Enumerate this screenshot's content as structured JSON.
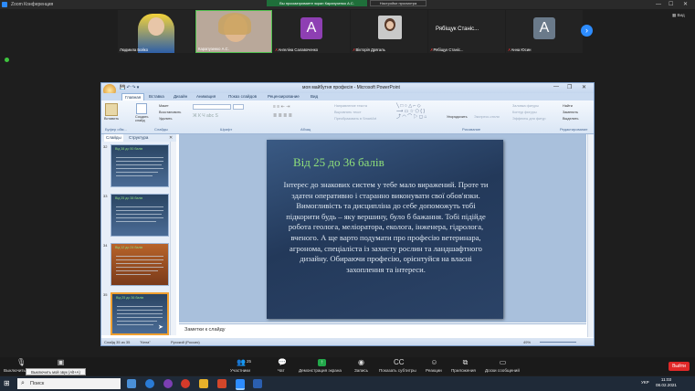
{
  "zoom": {
    "window_title": "Zoom Конференция",
    "banner": "Вы просматриваете экран Карапузенко А.С.",
    "banner_options": "Настройки просмотра",
    "view_label": "Вид",
    "participants": [
      {
        "name": "Людмила Бойко",
        "type": "video"
      },
      {
        "name": "Карапузенко А.С.",
        "type": "video"
      },
      {
        "name": "Ангеліна Салавоченко",
        "type": "avatar",
        "initial": "А",
        "color": "#8e3fb3",
        "muted": true
      },
      {
        "name": "Вікторія Дрягаль",
        "type": "photo",
        "muted": true
      },
      {
        "name": "Рябіщук Станіс...",
        "avatar_text": "Рябіщук Станіс...",
        "type": "text",
        "muted": true
      },
      {
        "name": "Анна Юсин",
        "type": "avatar",
        "initial": "А",
        "color": "#6a7a8a",
        "muted": true
      }
    ],
    "toolbar": {
      "audio": "Выключить",
      "video": "Включить",
      "participants": "Участники",
      "participants_count": "25",
      "chat": "Чат",
      "share": "Демонстрация экрана",
      "record": "Запись",
      "captions": "Показать субтитры",
      "reactions": "Реакции",
      "apps": "Приложения",
      "whiteboards": "Доски сообщений",
      "leave": "Выйти",
      "tooltip": "Выключить мой звук (Alt+A)"
    }
  },
  "ppt": {
    "title": "моя майбутня професія - Microsoft PowerPoint",
    "tabs": [
      "Главная",
      "Вставка",
      "Дизайн",
      "Анимация",
      "Показ слайдов",
      "Рецензирование",
      "Вид"
    ],
    "groups": [
      "Буфер обм...",
      "Слайды",
      "Шрифт",
      "Абзац",
      "Рисование",
      "Редактирование"
    ],
    "ribbon": {
      "paste": "Вставить",
      "new_slide": "Создать слайд",
      "layout": "Макет",
      "reset": "Восстановить",
      "delete": "Удалить",
      "arrange": "Упорядочить",
      "quick_styles": "Экспресс-стили",
      "find": "Найти",
      "replace": "Заменить",
      "select": "Выделить",
      "text_direction": "Направление текста",
      "align_text": "Выровнять текст",
      "smartart": "Преобразовать в SmartArt",
      "shape_fill": "Заливка фигуры",
      "shape_outline": "Контур фигуры",
      "shape_effects": "Эффекты для фигур"
    },
    "pane_tabs": [
      "Слайды",
      "Структура"
    ],
    "thumbnails": [
      {
        "num": "32",
        "heading": "Від 38 до 50 балів"
      },
      {
        "num": "33",
        "heading": "Від 25 до 38 балів"
      },
      {
        "num": "34",
        "heading": "Від 12 до 24 балів"
      },
      {
        "num": "35",
        "heading": "Від 25 до 36 балів"
      }
    ],
    "slide": {
      "title": "Від  25 до 36 балів",
      "body": "Інтерес до знакових систем у тебе мало виражений. Проте ти здатен оперативно і старанно виконувати свої обов'язки. Вимогливість та дисципліна  до себе допоможуть тобі підкорити будь – яку вершину, було б бажання. Тобі підійде робота геолога, меліоратора, еколога, інженера, гідролога, вченого. А ще варто подумати про професію ветеринара, агронома, спеціаліста із захисту рослин та ландшафтного дизайну. Обираючи професію, орієнтуйся на власні захоплення та інтереси."
    },
    "notes_placeholder": "Заметки к слайду",
    "status": {
      "slide": "Слайд 35 из 35",
      "theme": "\"Кела\"",
      "language": "Русский (Россия)",
      "zoom": "49%"
    }
  },
  "taskbar": {
    "search_placeholder": "Поиск",
    "lang": "УКР",
    "time": "11:03",
    "date": "08.02.2021"
  }
}
